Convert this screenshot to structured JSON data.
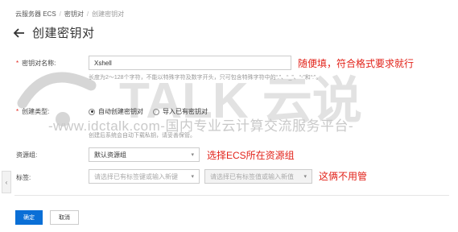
{
  "breadcrumb": {
    "items": [
      "云服务器 ECS",
      "密钥对",
      "创建密钥对"
    ]
  },
  "page": {
    "title": "创建密钥对"
  },
  "form": {
    "name": {
      "label": "密钥对名称:",
      "value": "Xshell",
      "hint_line1": "长度为2～128个字符，不能以特殊字符及数字开头，只可包含特殊字符中的“.”、“_”、“-”和“:”。",
      "note": "随便填，符合格式要求就行"
    },
    "type": {
      "label": "创建类型:",
      "options": [
        "自动创建密钥对",
        "导入已有密钥对"
      ],
      "selected": "自动创建密钥对",
      "hint": "创建后系统会自动下载私钥，请妥善保管。"
    },
    "resource_group": {
      "label": "资源组:",
      "value": "默认资源组",
      "note": "选择ECS所在资源组"
    },
    "tags": {
      "label": "标签:",
      "key_placeholder": "请选择已有标签键或输入新键",
      "value_placeholder": "请选择已有标签值或输入新值",
      "note": "这俩不用管"
    }
  },
  "watermark": {
    "brand": "TALK 云说",
    "line": "-www.idctalk.com-国内专业云计算交流服务平台-"
  },
  "buttons": {
    "confirm": "确定",
    "cancel": "取消"
  },
  "colors": {
    "accent": "#0a6fd6",
    "note_red": "#e2231a",
    "watermark": "#c9c9c9"
  },
  "icons": [
    "arrow-left-icon",
    "chevron-down-icon",
    "chevron-left-icon"
  ]
}
